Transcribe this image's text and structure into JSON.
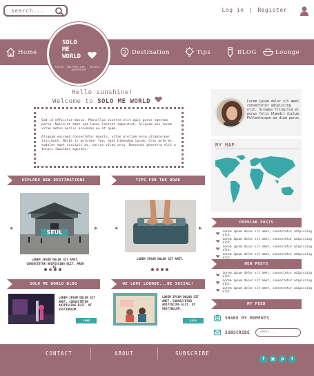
{
  "header": {
    "search_placeholder": "search...",
    "login": "Log in",
    "separator": "|",
    "register": "Register"
  },
  "nav": {
    "home": "Home",
    "destination": "Destination",
    "tips": "Tips",
    "blog": "BLOG",
    "lounge": "Lounge"
  },
  "logo": {
    "line1": "SOLO",
    "line2": "ME",
    "line3": "WORLD",
    "tagline": "TRAVEL INSPIRATION - GUIDES - ADVENTURE"
  },
  "welcome": {
    "hello": "Hello sunshine!",
    "welcome_prefix": "Welcome to",
    "brand": "SOLO ME WORLD",
    "para1": "Sed id efficitur massa. Phasellus viverra elit quis purus egestas porta. Nulla et amet sed lacus laoreet imperdiet. Aliquam non lorem vitae metus mollis accumsan eu at quam.",
    "para2": "Aliquam euismod consectetur mauris, vitae pretium enim ullamcorper tincidunt. Morbi in pulvinar leo, eget bibendum ipsum. Cras ante mi, sodales eget suscipit at, varius vitae arcu. Maecenas pharetra elit a turpis faucibus egestas."
  },
  "profile": {
    "text": "Lorem ipsum dolor sit amet, consectetur adipiscing elit. Vivamus fringilla et purus felis blandit dictum. Pellentesque eu diam purus."
  },
  "map": {
    "title": "MY MAP"
  },
  "sections": {
    "explore": "EXPLORE NEW DESTINATIONS",
    "tips": "TIPS FOR THE ROAD",
    "popular": "POPULAR POSTS",
    "new_posts": "NEW POSTS",
    "blog": "SOLO ME WORLD BLOG",
    "lounge": "WE LOVE LOUNGE...BE SOCIAL!",
    "feed": "MY FEED"
  },
  "explore": {
    "sign": "SEUL",
    "caption": "LOREM IPSUM DOLOR SIT AMET, CONSECTETUR ADIPISCING ELIT. MAUR IS."
  },
  "tips": {
    "caption": "LOREM IPSUM DOLOR SIT AMET."
  },
  "popular_items": [
    "Lorem ipsum dolor sit amet, consectetur adipiscing elit.",
    "Lorem ipsum dolor sit amet, consectetur adipiscing elit.",
    "Lorem ipsum dolor sit amet, consectetur adipiscing elit.",
    "Lorem ipsum dolor sit amet, consectetur adipiscing elit."
  ],
  "new_items": [
    "Lorem ipsum dolor sit amet, consectetur adipiscing elit.",
    "Lorem ipsum dolor sit amet, consectetur adipiscing elit.",
    "Lorem ipsum dolor sit amet, consectetur adipiscing elit."
  ],
  "blog": {
    "text": "LOREM IPSUM DOLOR SIT AMET, CONSECTETUR ADIPISCING ELIT. UT VESTIBULUM.",
    "button": "read"
  },
  "lounge": {
    "text": "LOREM IPSUM DOLOR SIT AMET, CONSECTETUR ADIPISCING ELIT. UT VESTIBULUM.",
    "button": "join"
  },
  "feed": {
    "share": "SHARE MY MOMENTS",
    "subscribe": "SUBSCRIBE",
    "email_placeholder": "email..."
  },
  "footer": {
    "contact": "CONTACT",
    "about": "ABOUT",
    "subscribe": "SUBSCRIBE"
  },
  "colors": {
    "brand": "#9c6c74",
    "accent": "#3aa8a8"
  }
}
